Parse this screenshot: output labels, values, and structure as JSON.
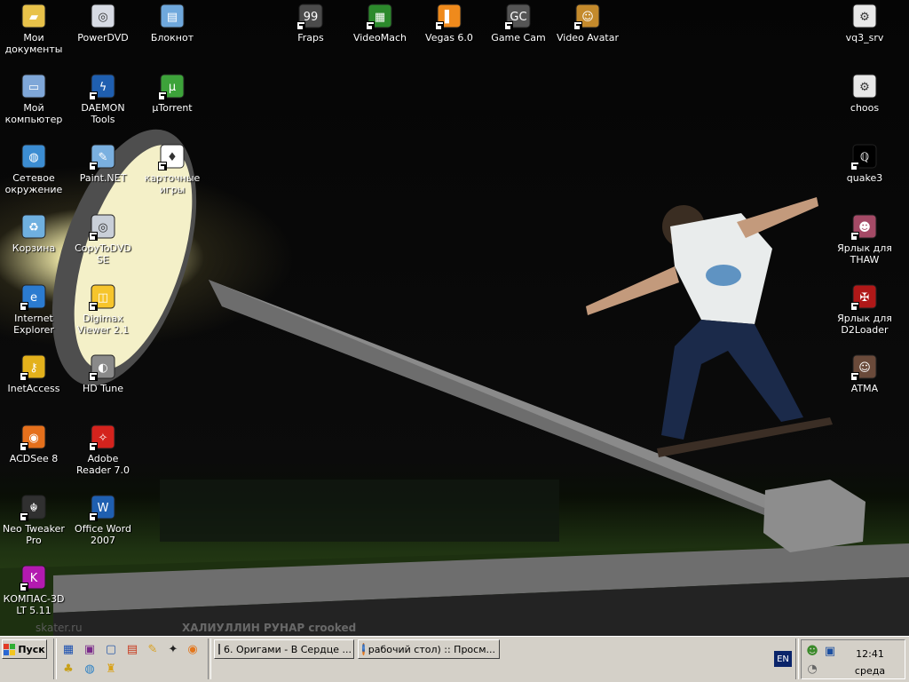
{
  "desktop": {
    "icons": [
      {
        "label": "Мои документы"
      },
      {
        "label": "PowerDVD"
      },
      {
        "label": "Блокнот"
      },
      {
        "label": "Fraps"
      },
      {
        "label": "VideoMach"
      },
      {
        "label": "Vegas 6.0"
      },
      {
        "label": "Game Cam"
      },
      {
        "label": "Video Avatar"
      },
      {
        "label": "vq3_srv"
      },
      {
        "label": "Мой компьютер"
      },
      {
        "label": "DAEMON Tools"
      },
      {
        "label": "µTorrent"
      },
      {
        "label": "choos"
      },
      {
        "label": "Сетевое окружение"
      },
      {
        "label": "Paint.NET"
      },
      {
        "label": "карточные игры"
      },
      {
        "label": "quake3"
      },
      {
        "label": "Корзина"
      },
      {
        "label": "CopyToDVD SE"
      },
      {
        "label": "Ярлык для THAW"
      },
      {
        "label": "Internet Explorer"
      },
      {
        "label": "Digimax Viewer 2.1"
      },
      {
        "label": "Ярлык для D2Loader"
      },
      {
        "label": "InetAccess"
      },
      {
        "label": "HD Tune"
      },
      {
        "label": "ATMA"
      },
      {
        "label": "ACDSee 8"
      },
      {
        "label": "Adobe Reader 7.0"
      },
      {
        "label": "Neo Tweaker Pro"
      },
      {
        "label": "Office Word 2007"
      },
      {
        "label": "КОМПАС-3D LT 5.11"
      }
    ],
    "watermark": {
      "caption": "ХАЛИУЛЛИН РУНАР crooked",
      "site": "skater.ru"
    }
  },
  "taskbar": {
    "start_label": "Пуск",
    "tasks": [
      {
        "label": "6. Оригами - В Сердце ..."
      },
      {
        "label": "рабочий стол) :: Просм..."
      }
    ],
    "language": "EN",
    "clock": {
      "time": "12:41",
      "day": "среда"
    }
  }
}
